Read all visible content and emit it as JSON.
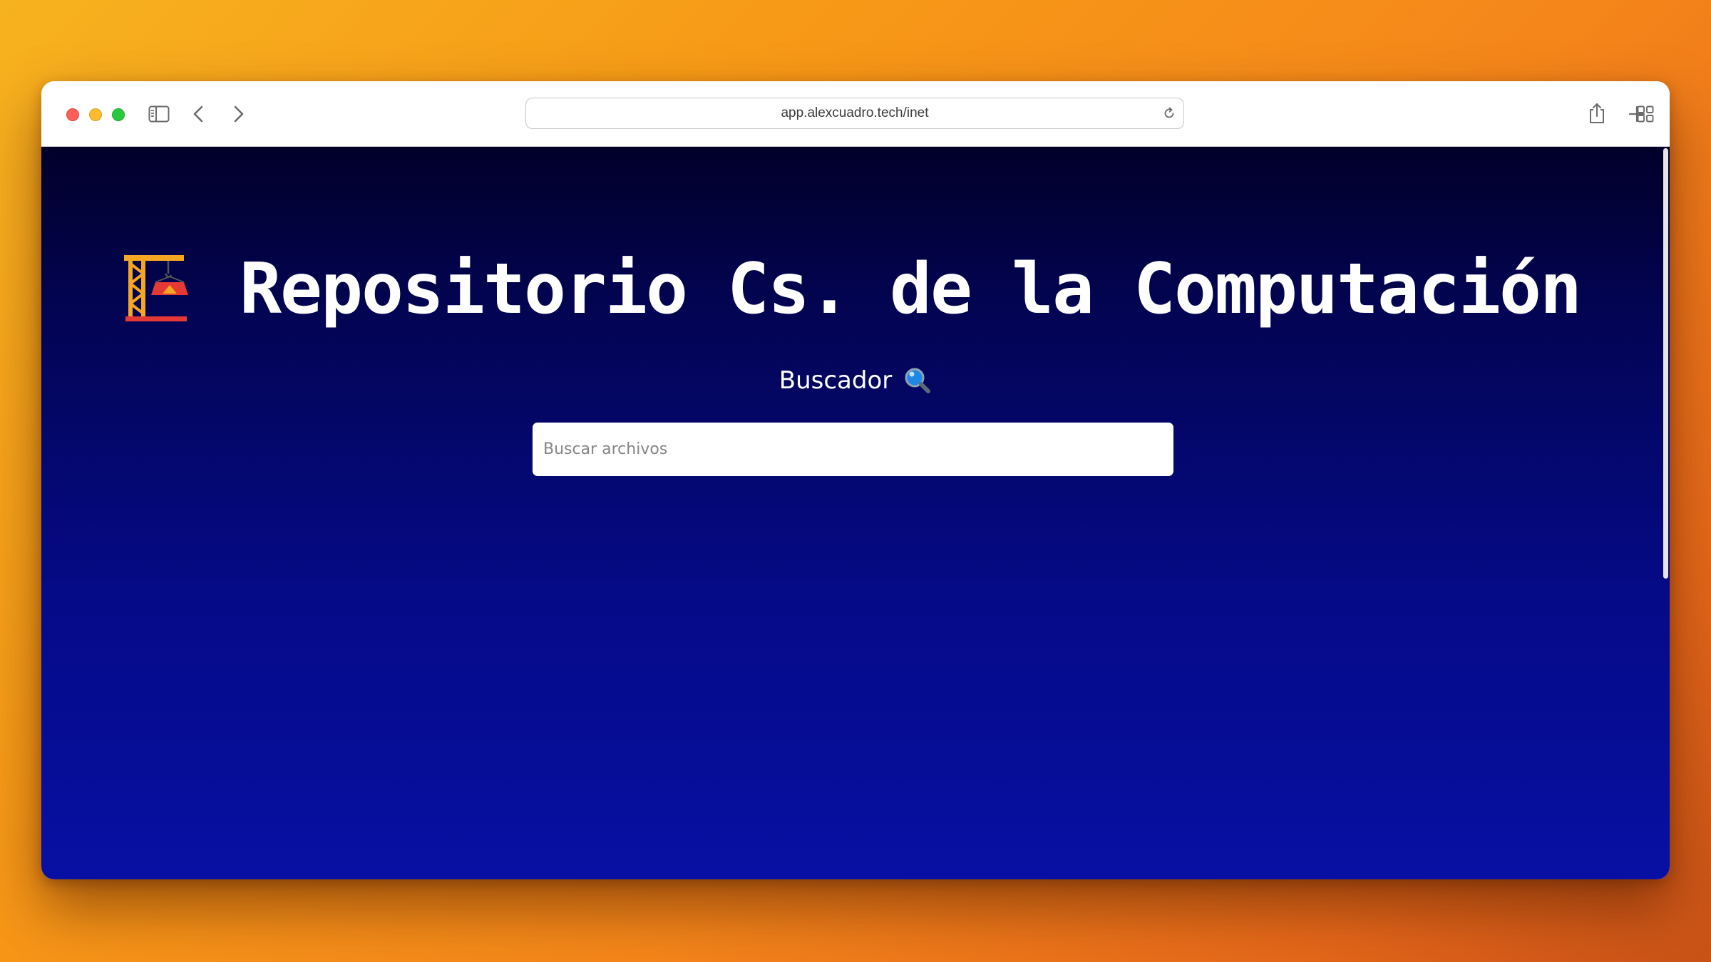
{
  "browser": {
    "url": "app.alexcuadro.tech/inet",
    "buttons": {
      "close": "close-window",
      "minimize": "minimize-window",
      "zoom": "zoom-window",
      "sidebar": "sidebar-icon",
      "back": "back-icon",
      "forward": "forward-icon",
      "reload": "reload-icon",
      "share": "share-icon",
      "new_tab": "plus-icon",
      "tab_overview": "tab-grid-icon"
    }
  },
  "page": {
    "title": "Repositorio Cs. de la Computación",
    "title_icon": "construction-crane-icon",
    "subtitle": "Buscador",
    "subtitle_icon": "magnifying-glass-icon",
    "search": {
      "placeholder": "Buscar archivos",
      "value": ""
    }
  },
  "colors": {
    "background_top": "#01002a",
    "background_bottom": "#0710a3",
    "wallpaper": "#f5861a",
    "title_text": "#ffffff"
  }
}
